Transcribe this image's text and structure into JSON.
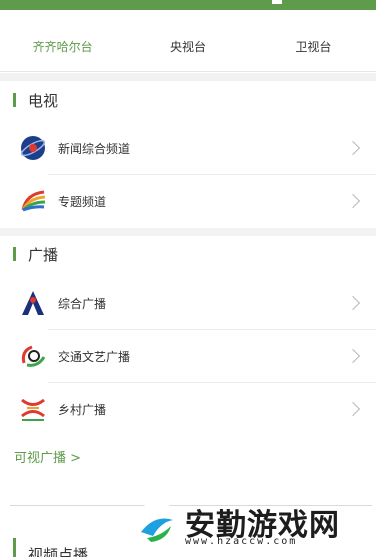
{
  "tabs": [
    {
      "label": "齐齐哈尔台",
      "active": true
    },
    {
      "label": "央视台",
      "active": false
    },
    {
      "label": "卫视台",
      "active": false
    }
  ],
  "sections": {
    "tv": {
      "title": "电视",
      "items": [
        {
          "label": "新闻综合频道",
          "icon": "news-channel-logo-icon"
        },
        {
          "label": "专题频道",
          "icon": "special-channel-logo-icon"
        }
      ]
    },
    "radio": {
      "title": "广播",
      "items": [
        {
          "label": "综合广播",
          "icon": "general-radio-logo-icon"
        },
        {
          "label": "交通文艺广播",
          "icon": "traffic-radio-logo-icon"
        },
        {
          "label": "乡村广播",
          "icon": "rural-radio-logo-icon"
        }
      ]
    },
    "video": {
      "title": "视频点播"
    }
  },
  "more_link": "可视广播 >",
  "watermark": {
    "text": "安勤游戏网",
    "url": "www.hzaccw.com"
  },
  "colors": {
    "accent": "#5e9b4a",
    "gap": "#f2f2f2",
    "divider": "#ececec"
  }
}
